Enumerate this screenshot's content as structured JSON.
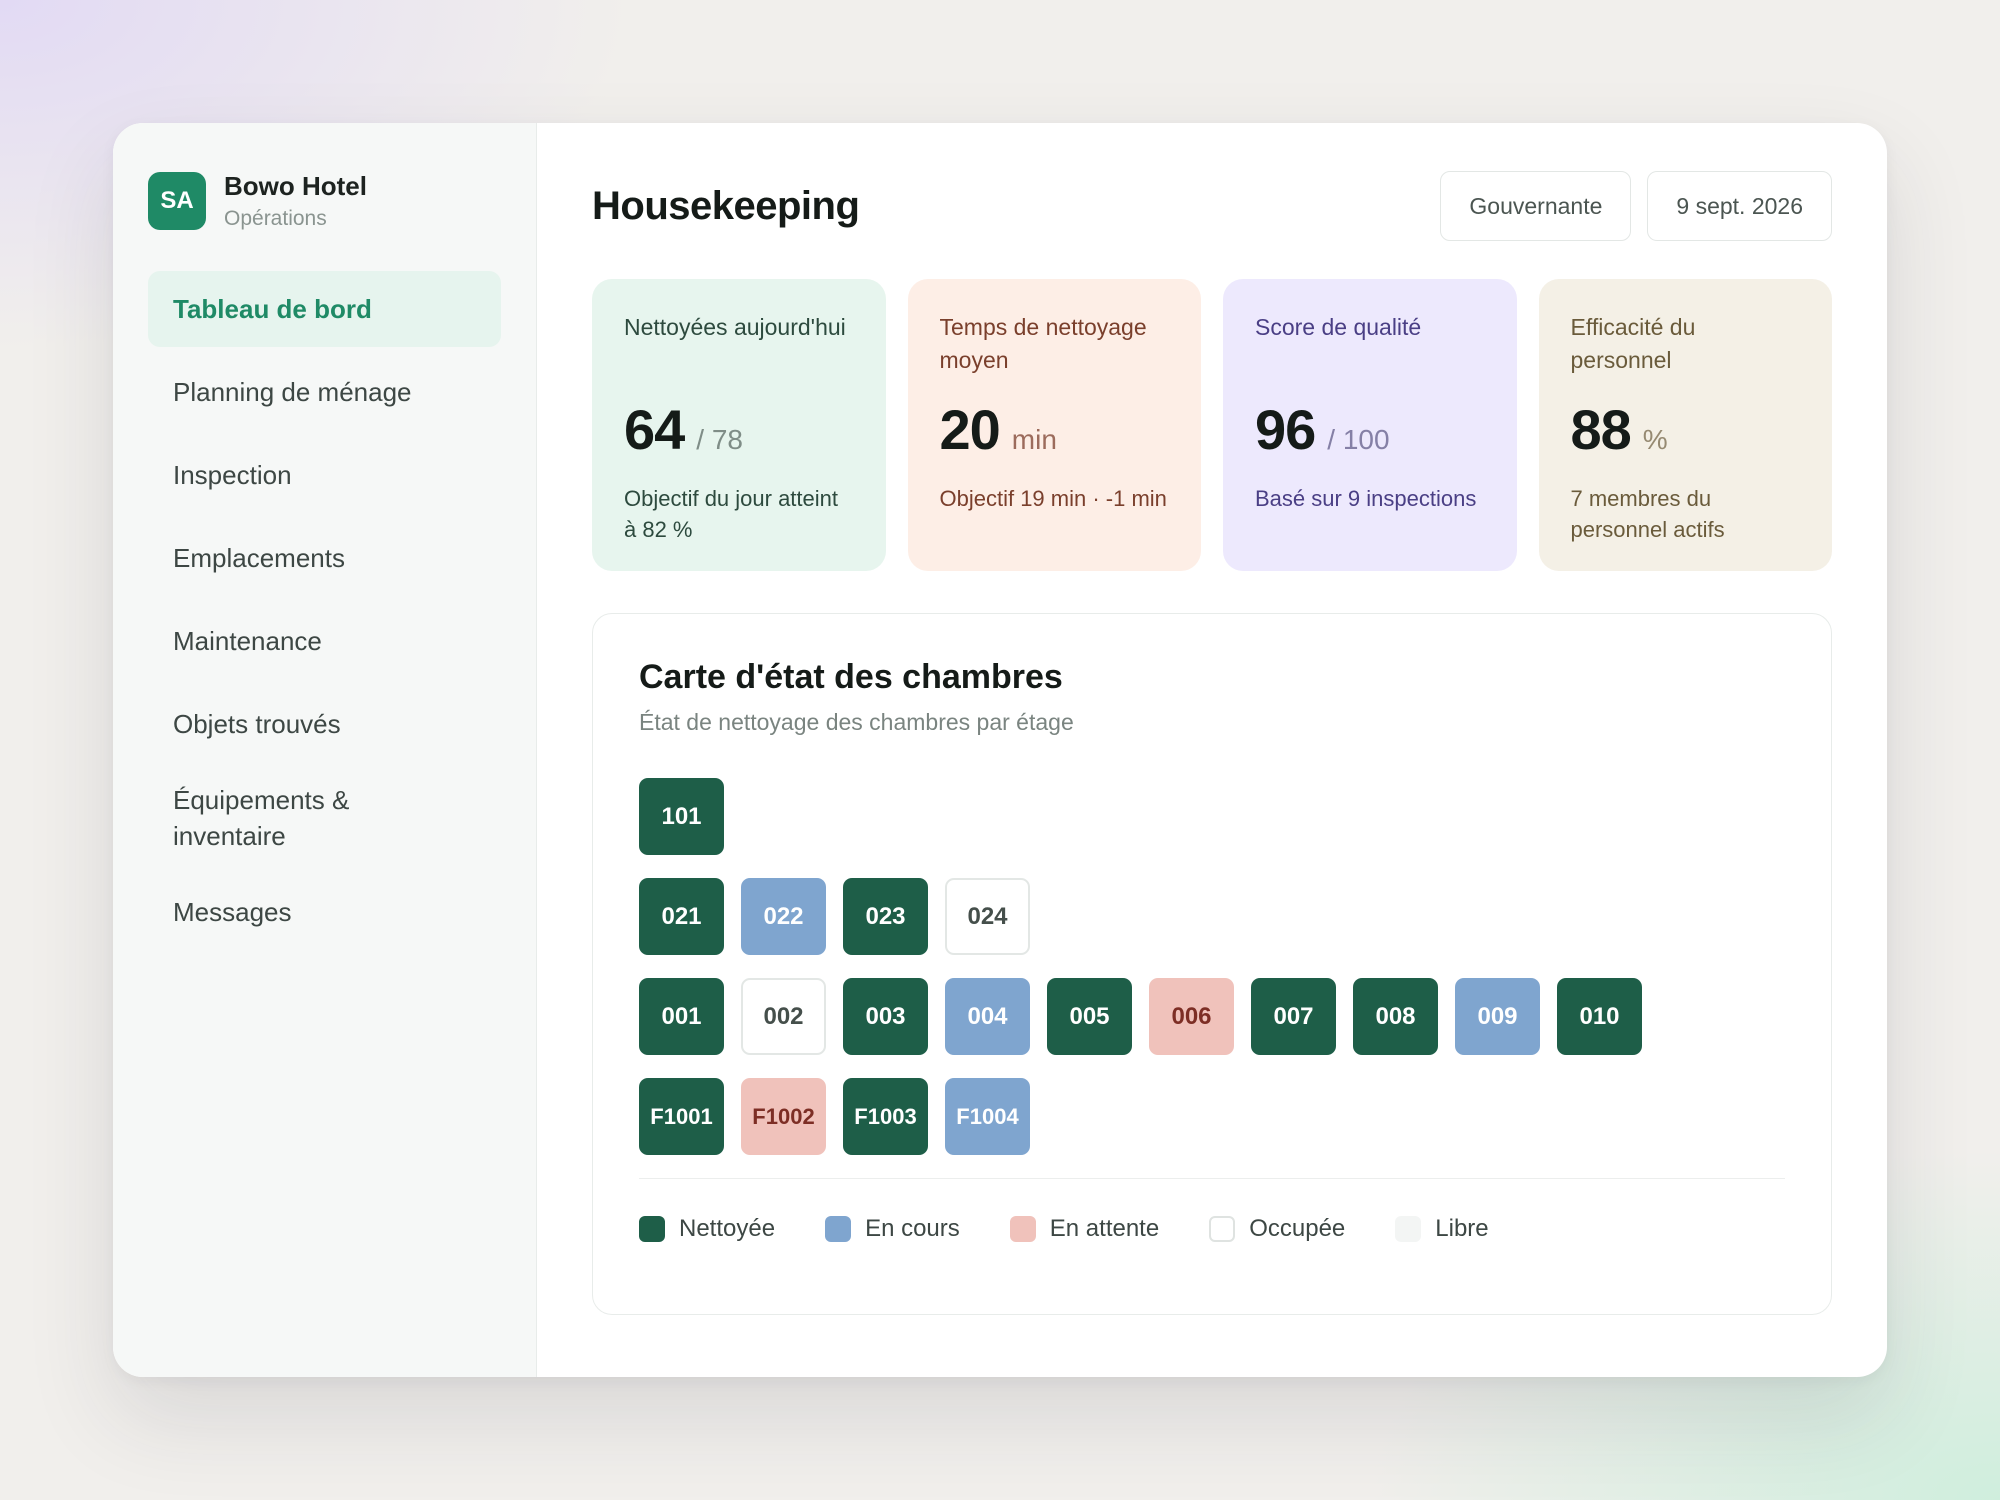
{
  "brand": {
    "initials": "SA",
    "name": "Bowo Hotel",
    "subtitle": "Opérations"
  },
  "sidebar": {
    "items": [
      {
        "label": "Tableau de bord",
        "active": true
      },
      {
        "label": "Planning de ménage"
      },
      {
        "label": "Inspection"
      },
      {
        "label": "Emplacements"
      },
      {
        "label": "Maintenance"
      },
      {
        "label": "Objets trouvés"
      },
      {
        "label": "Équipements & inventaire"
      },
      {
        "label": "Messages"
      }
    ]
  },
  "header": {
    "title": "Housekeeping",
    "role": "Gouvernante",
    "date": "9 sept. 2026"
  },
  "cards": [
    {
      "label": "Nettoyées aujourd'hui",
      "value": "64",
      "unit": "/ 78",
      "note": "Objectif du jour atteint à 82 %"
    },
    {
      "label": "Temps de nettoyage moyen",
      "value": "20",
      "unit": "min",
      "note": "Objectif 19 min · -1 min"
    },
    {
      "label": "Score de qualité",
      "value": "96",
      "unit": "/ 100",
      "note": "Basé sur 9 inspections"
    },
    {
      "label": "Efficacité du personnel",
      "value": "88",
      "unit": "%",
      "note": "7 membres du personnel actifs"
    }
  ],
  "room_map": {
    "title": "Carte d'état des chambres",
    "subtitle": "État de nettoyage des chambres par étage",
    "floors": [
      {
        "rooms": [
          {
            "number": "101",
            "status": "clean"
          }
        ]
      },
      {
        "rooms": [
          {
            "number": "021",
            "status": "clean"
          },
          {
            "number": "022",
            "status": "progress"
          },
          {
            "number": "023",
            "status": "clean"
          },
          {
            "number": "024",
            "status": "occupied"
          }
        ]
      },
      {
        "rooms": [
          {
            "number": "001",
            "status": "clean"
          },
          {
            "number": "002",
            "status": "occupied"
          },
          {
            "number": "003",
            "status": "clean"
          },
          {
            "number": "004",
            "status": "progress"
          },
          {
            "number": "005",
            "status": "clean"
          },
          {
            "number": "006",
            "status": "pending"
          },
          {
            "number": "007",
            "status": "clean"
          },
          {
            "number": "008",
            "status": "clean"
          },
          {
            "number": "009",
            "status": "progress"
          },
          {
            "number": "010",
            "status": "clean"
          }
        ]
      },
      {
        "rooms": [
          {
            "number": "F1001",
            "status": "clean"
          },
          {
            "number": "F1002",
            "status": "pending"
          },
          {
            "number": "F1003",
            "status": "clean"
          },
          {
            "number": "F1004",
            "status": "progress"
          }
        ]
      }
    ],
    "legend": [
      {
        "status": "clean",
        "label": "Nettoyée",
        "color": "#1e5e48"
      },
      {
        "status": "progress",
        "label": "En cours",
        "color": "#7fa5cf"
      },
      {
        "status": "pending",
        "label": "En attente",
        "color": "#f0c2bb"
      },
      {
        "status": "occupied",
        "label": "Occupée",
        "color": "#ffffff"
      },
      {
        "status": "free",
        "label": "Libre",
        "color": "#f3f5f4"
      }
    ]
  },
  "colors": {
    "accent": "#1f8a66",
    "accent_soft": "#e6f4ee"
  }
}
